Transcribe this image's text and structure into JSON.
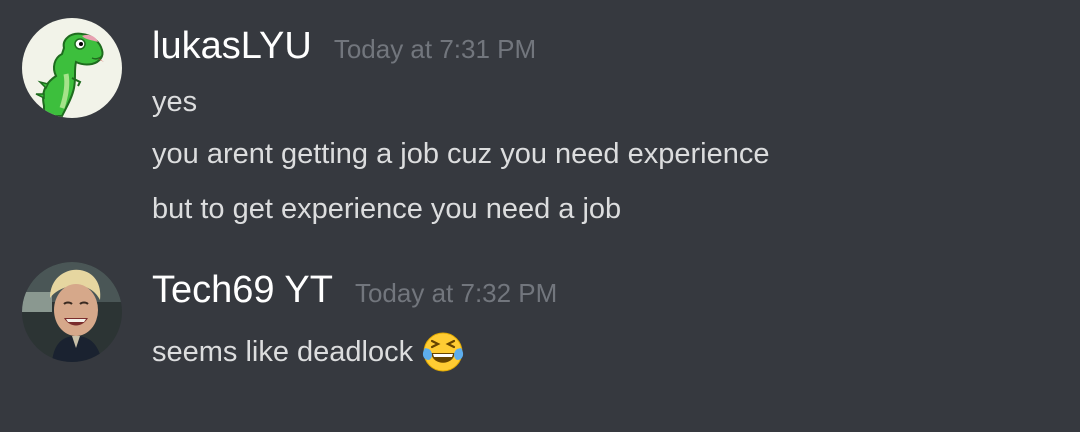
{
  "messages": [
    {
      "avatar_icon": "green-dinosaur-avatar",
      "username": "lukasLYU",
      "timestamp": "Today at 7:31 PM",
      "lines": [
        "yes",
        "you arent getting a job cuz you need experience",
        "but to get experience you need a job"
      ]
    },
    {
      "avatar_icon": "smiling-man-photo-avatar",
      "username": "Tech69 YT",
      "timestamp": "Today at 7:32 PM",
      "lines": [
        "seems like deadlock"
      ],
      "emoji": "face-with-tears-of-joy-emoji"
    }
  ],
  "colors": {
    "background": "#36393f",
    "username": "#ffffff",
    "timestamp": "#72767d",
    "message_text": "#dcddde"
  }
}
